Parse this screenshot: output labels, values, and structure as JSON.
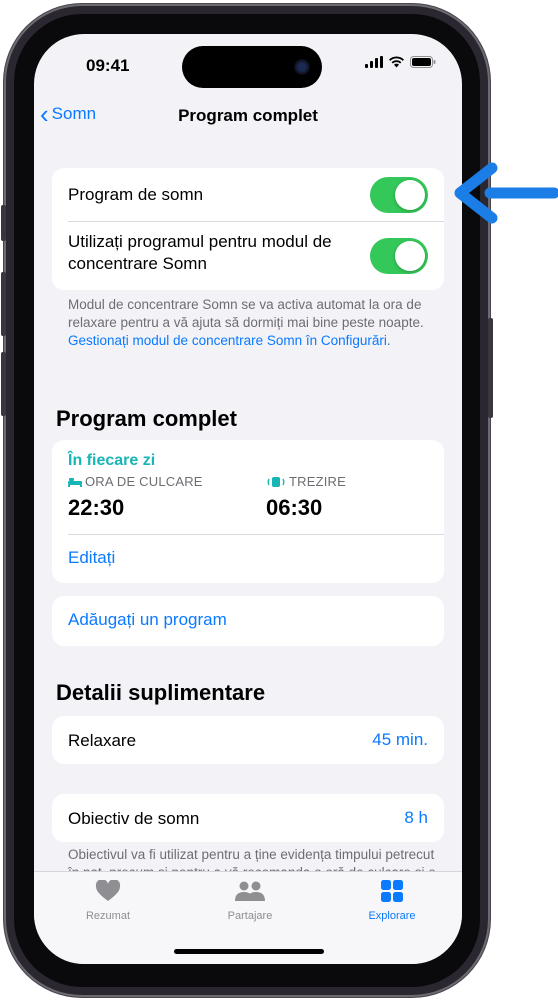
{
  "status_bar": {
    "time": "09:41"
  },
  "nav": {
    "back_label": "Somn",
    "title": "Program complet"
  },
  "settings": {
    "sleep_schedule_label": "Program de somn",
    "sleep_schedule_on": true,
    "focus_label": "Utilizați programul pentru modul de concentrare Somn",
    "focus_on": true,
    "footnote_text": "Modul de concentrare Somn se va activa automat la ora de relaxare pentru a vă ajuta să dormiți mai bine peste noapte. ",
    "footnote_link": "Gestionați modul de concentrare Somn în Configurări."
  },
  "full_schedule": {
    "section_title": "Program complet",
    "days_label": "În fiecare zi",
    "bedtime_label": "ORA DE CULCARE",
    "bedtime_value": "22:30",
    "wake_label": "TREZIRE",
    "wake_value": "06:30",
    "edit_label": "Editați",
    "add_schedule_label": "Adăugați un program"
  },
  "details": {
    "section_title": "Detalii suplimentare",
    "wind_down_label": "Relaxare",
    "wind_down_value": "45 min.",
    "sleep_goal_label": "Obiectiv de somn",
    "sleep_goal_value": "8 h",
    "sleep_goal_note": "Obiectivul va fi utilizat pentru a ține evidența timpului petrecut în pat, precum și pentru a vă recomanda o oră de culcare și o alarmă de trezire."
  },
  "tab_bar": {
    "tabs": [
      {
        "label": "Rezumat",
        "icon": "heart-icon",
        "active": false
      },
      {
        "label": "Partajare",
        "icon": "people-icon",
        "active": false
      },
      {
        "label": "Explorare",
        "icon": "grid-icon",
        "active": true
      }
    ]
  },
  "annotation": {
    "icon": "arrow-left-icon",
    "color": "#1a7ee6"
  },
  "colors": {
    "accent": "#0a7aff",
    "toggle_on": "#34c759",
    "teal": "#18b5b6"
  }
}
